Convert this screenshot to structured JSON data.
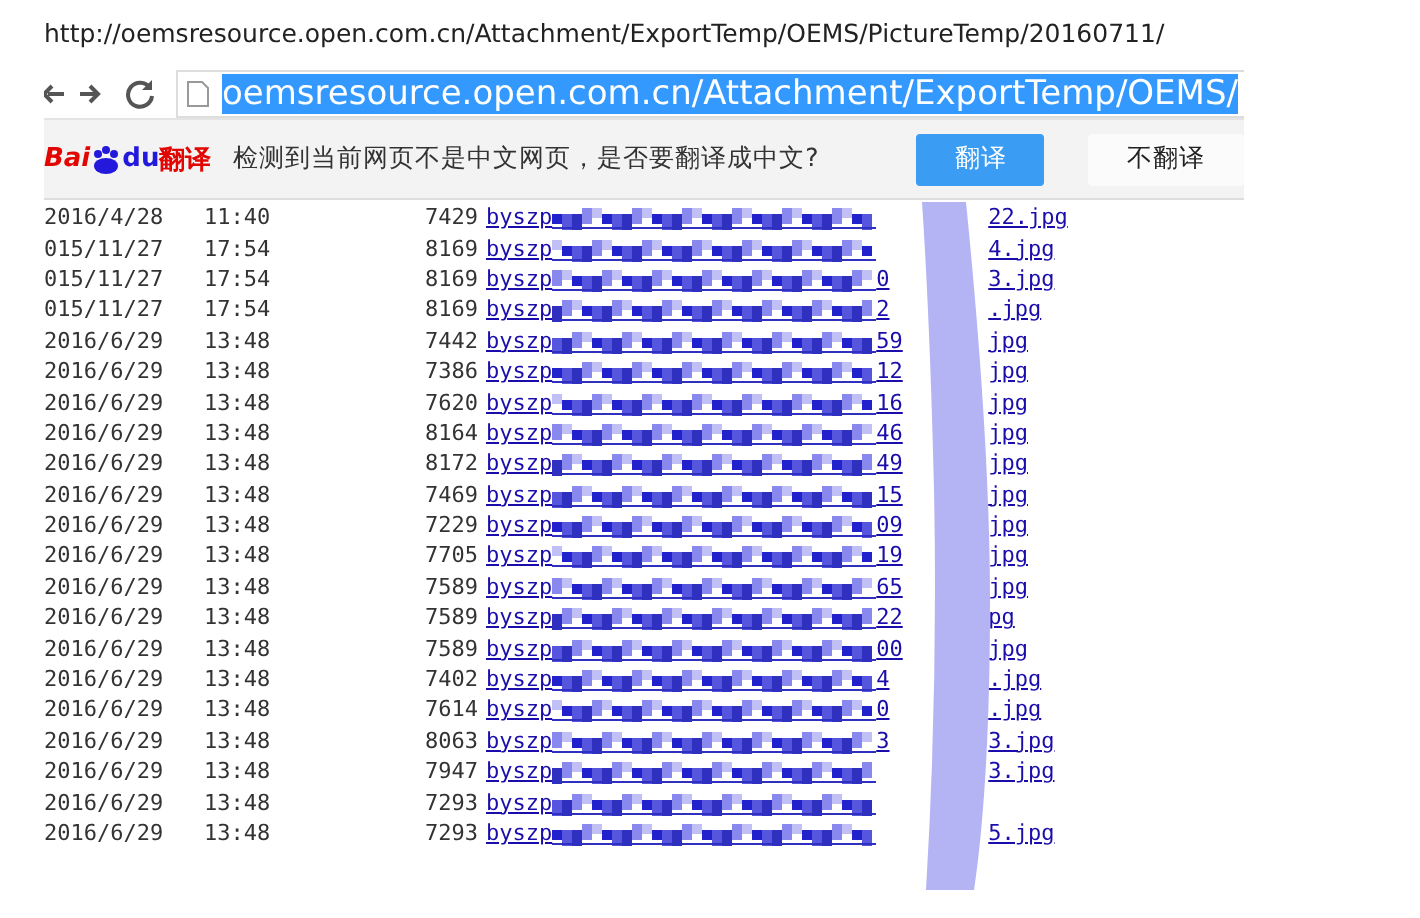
{
  "page_url": "http://oemsresource.open.com.cn/Attachment/ExportTemp/OEMS/PictureTemp/20160711/",
  "browser": {
    "address": "oemsresource.open.com.cn/Attachment/ExportTemp/OEMS/",
    "address_selected": true
  },
  "translate_bar": {
    "logo": {
      "first": "Bai",
      "second": "du",
      "third": "翻译"
    },
    "message": "检测到当前网页不是中文网页，是否要翻译成中文?",
    "buttons": [
      {
        "label": "翻译",
        "primary": true
      },
      {
        "label": "不翻译",
        "primary": false
      }
    ]
  },
  "listing": [
    {
      "date": "2016/4/28",
      "time": "11:40",
      "size": "7429",
      "name_start": "byszp",
      "name_end": "22.jpg"
    },
    {
      "date": "015/11/27",
      "time": "17:54",
      "size": "8169",
      "name_start": "byszp",
      "name_end": "4.jpg"
    },
    {
      "date": "015/11/27",
      "time": "17:54",
      "size": "8169",
      "name_start": "byszp",
      "name_part": "0",
      "name_end": "3.jpg"
    },
    {
      "date": "015/11/27",
      "time": "17:54",
      "size": "8169",
      "name_start": "byszp",
      "name_part": "2",
      "name_end": ".jpg"
    },
    {
      "date": "2016/6/29",
      "time": "13:48",
      "size": "7442",
      "name_start": "byszp",
      "name_part": "59",
      "name_end": "jpg"
    },
    {
      "date": "2016/6/29",
      "time": "13:48",
      "size": "7386",
      "name_start": "byszp",
      "name_part": "12",
      "name_end": "jpg"
    },
    {
      "date": "2016/6/29",
      "time": "13:48",
      "size": "7620",
      "name_start": "byszp",
      "name_part": "16",
      "name_end": "jpg"
    },
    {
      "date": "2016/6/29",
      "time": "13:48",
      "size": "8164",
      "name_start": "byszp",
      "name_part": "46",
      "name_end": "jpg"
    },
    {
      "date": "2016/6/29",
      "time": "13:48",
      "size": "8172",
      "name_start": "byszp",
      "name_part": "49",
      "name_end": "jpg"
    },
    {
      "date": "2016/6/29",
      "time": "13:48",
      "size": "7469",
      "name_start": "byszp",
      "name_part": "15",
      "name_end": "jpg"
    },
    {
      "date": "2016/6/29",
      "time": "13:48",
      "size": "7229",
      "name_start": "byszp",
      "name_part": "09",
      "name_end": "jpg"
    },
    {
      "date": "2016/6/29",
      "time": "13:48",
      "size": "7705",
      "name_start": "byszp",
      "name_part": "19",
      "name_end": "jpg"
    },
    {
      "date": "2016/6/29",
      "time": "13:48",
      "size": "7589",
      "name_start": "byszp",
      "name_part": "65",
      "name_end": "jpg"
    },
    {
      "date": "2016/6/29",
      "time": "13:48",
      "size": "7589",
      "name_start": "byszp",
      "name_part": "22",
      "name_end": "pg"
    },
    {
      "date": "2016/6/29",
      "time": "13:48",
      "size": "7589",
      "name_start": "byszp",
      "name_part": "00",
      "name_end": "jpg"
    },
    {
      "date": "2016/6/29",
      "time": "13:48",
      "size": "7402",
      "name_start": "byszp",
      "name_part": "4",
      "name_end": ".jpg"
    },
    {
      "date": "2016/6/29",
      "time": "13:48",
      "size": "7614",
      "name_start": "byszp",
      "name_part": "0",
      "name_end": ".jpg"
    },
    {
      "date": "2016/6/29",
      "time": "13:48",
      "size": "8063",
      "name_start": "byszp",
      "name_part": "3",
      "name_end": "3.jpg"
    },
    {
      "date": "2016/6/29",
      "time": "13:48",
      "size": "7947",
      "name_start": "byszp",
      "name_end": "3.jpg"
    },
    {
      "date": "2016/6/29",
      "time": "13:48",
      "size": "7293",
      "name_start": "byszp"
    },
    {
      "date": "2016/6/29",
      "time": "13:48",
      "size": "7293",
      "name_start": "byszp",
      "name_end": "5.jpg"
    }
  ]
}
